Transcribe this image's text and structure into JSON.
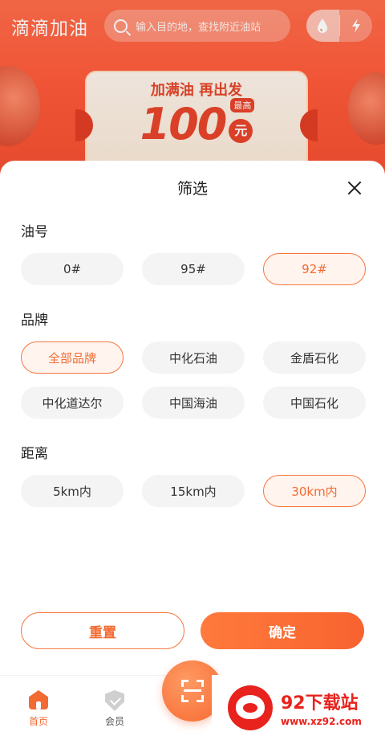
{
  "header": {
    "app_name": "滴滴加油",
    "search_placeholder": "输入目的地，查找附近油站",
    "fuel_icon": "water-drop-icon",
    "electric_icon": "lightning-icon"
  },
  "banner": {
    "title": "加满油 再出发",
    "amount": "100",
    "unit": "元",
    "max_tag": "最高"
  },
  "filter": {
    "title": "筛选",
    "close_icon": "close-icon",
    "sections": {
      "oil": {
        "title": "油号",
        "options": [
          "0#",
          "95#",
          "92#"
        ],
        "selected": "92#"
      },
      "brand": {
        "title": "品牌",
        "options": [
          "全部品牌",
          "中化石油",
          "金盾石化",
          "中化道达尔",
          "中国海油",
          "中国石化"
        ],
        "selected": "全部品牌"
      },
      "distance": {
        "title": "距离",
        "options": [
          "5km内",
          "15km内",
          "30km内"
        ],
        "selected": "30km内"
      }
    },
    "reset_label": "重置",
    "confirm_label": "确定"
  },
  "tabbar": {
    "home_label": "首页",
    "member_label": "会员",
    "scan_icon": "scan-icon"
  },
  "watermark": {
    "title": "92下载站",
    "url": "www.xz92.com"
  },
  "colors": {
    "accent": "#f26b33",
    "header_bg": "#ff5a3a",
    "chip_bg": "#f4f4f4",
    "selected_chip_bg": "#fff4ee"
  }
}
